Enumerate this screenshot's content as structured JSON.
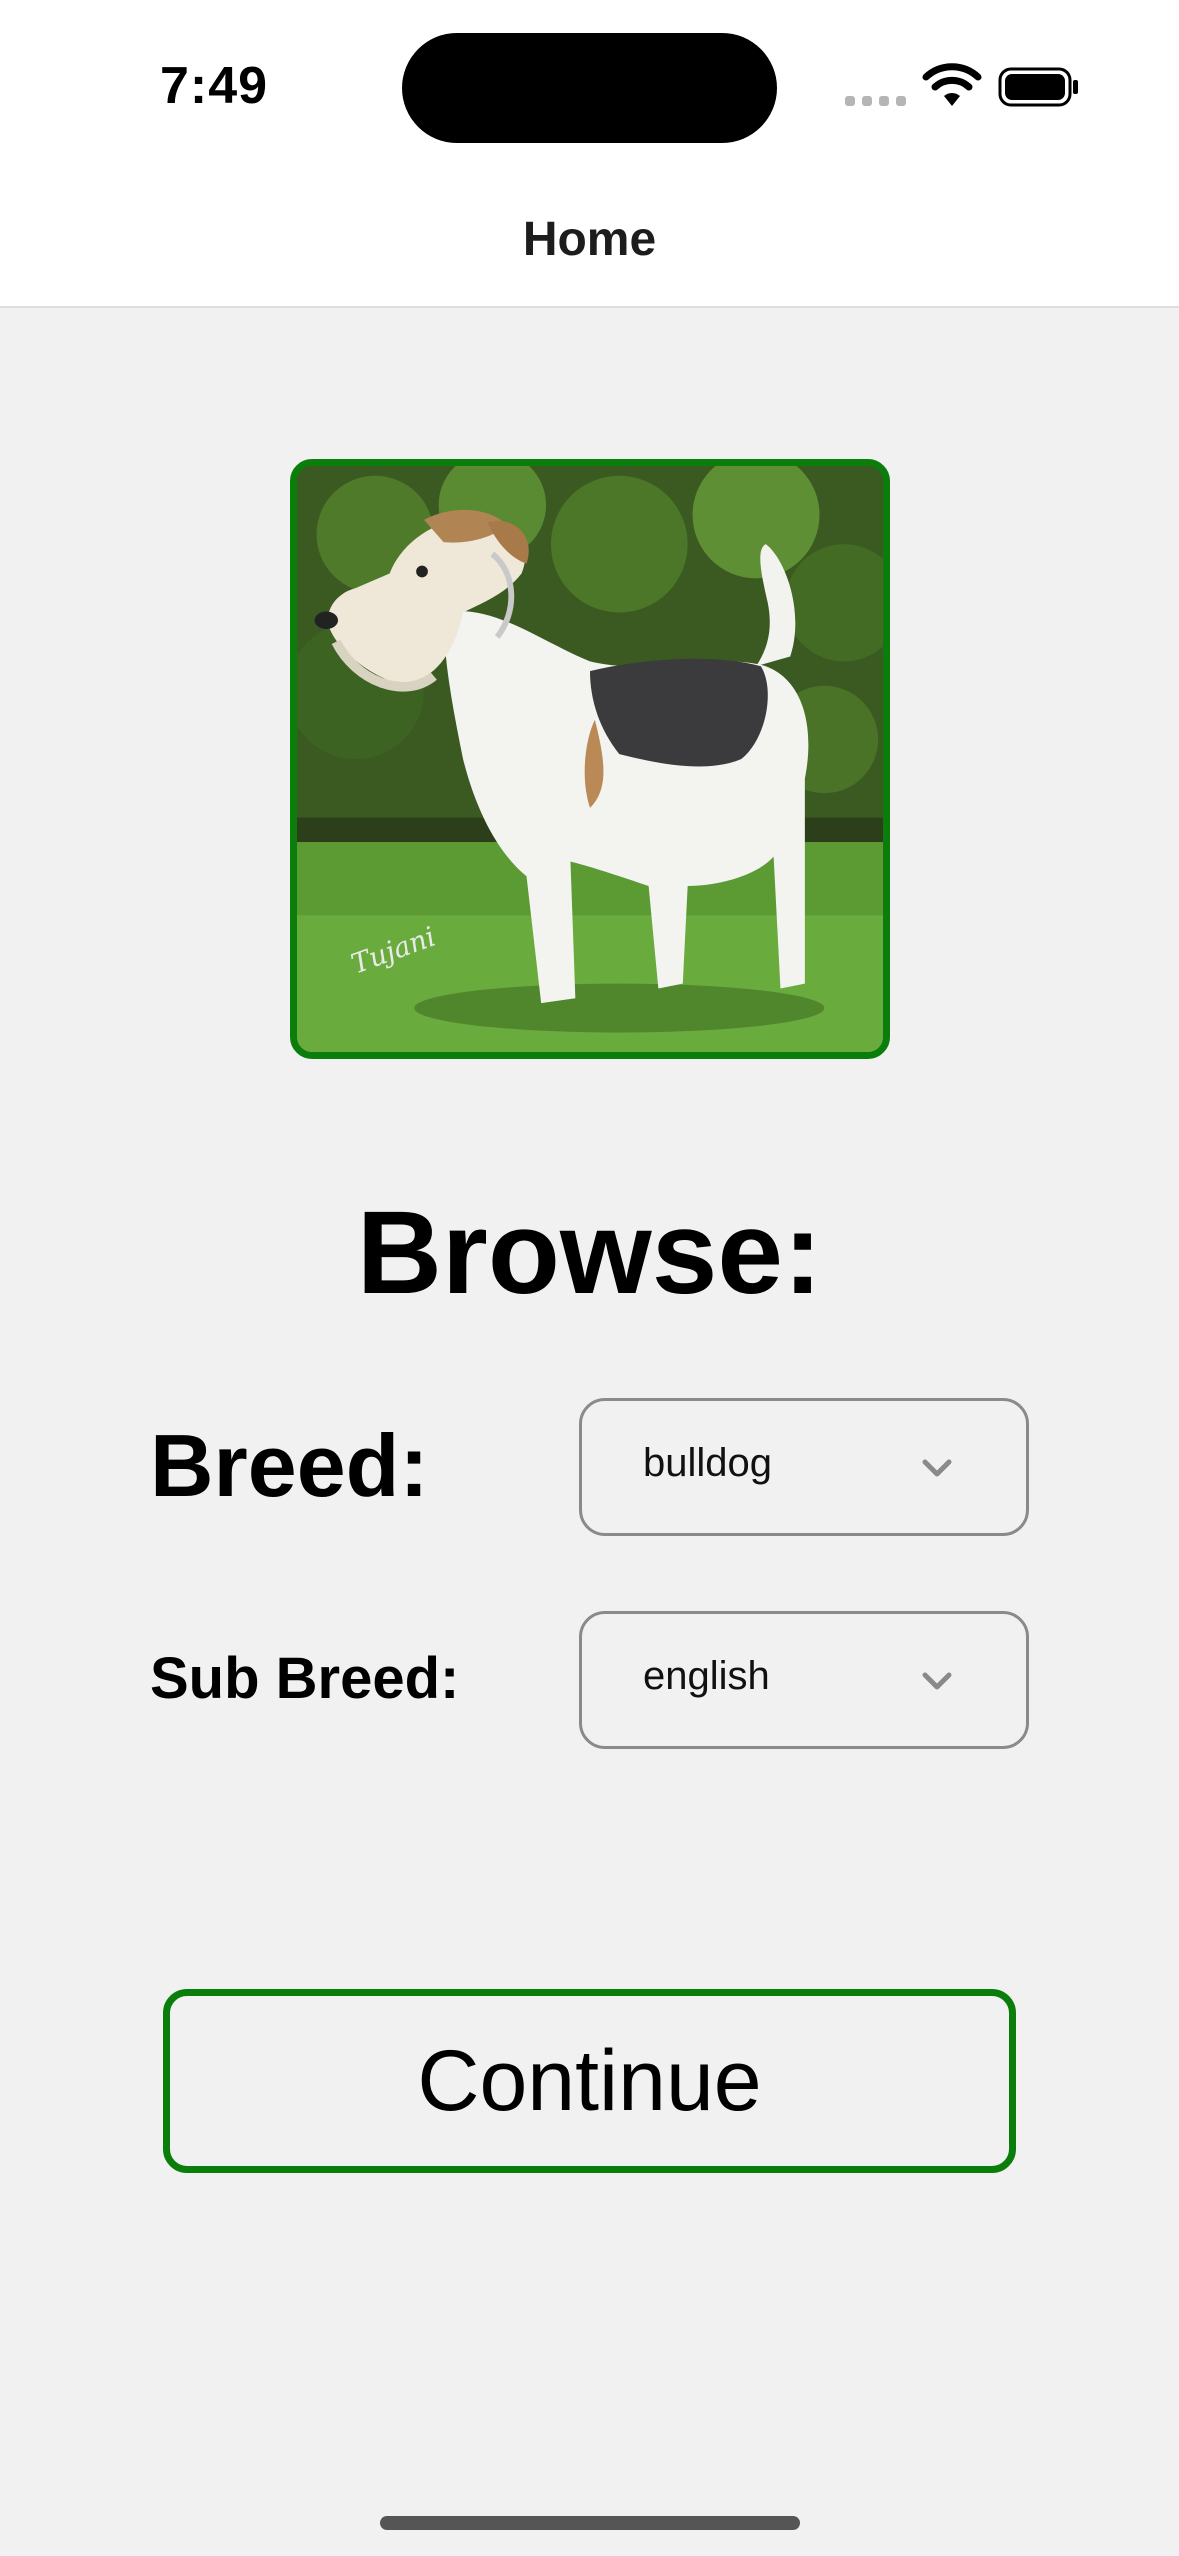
{
  "status_bar": {
    "time": "7:49",
    "icons": [
      "cellular-signal-icon",
      "wifi-icon",
      "battery-icon"
    ]
  },
  "nav": {
    "title": "Home"
  },
  "image": {
    "subject": "dog-photo",
    "border_color": "#0a7d0a",
    "signature": "Tujani"
  },
  "browse": {
    "heading": "Browse:",
    "breed_label": "Breed:",
    "breed_value": "bulldog",
    "sub_breed_label": "Sub Breed:",
    "sub_breed_value": "english"
  },
  "actions": {
    "continue_label": "Continue",
    "accent_color": "#0a7d0a"
  }
}
